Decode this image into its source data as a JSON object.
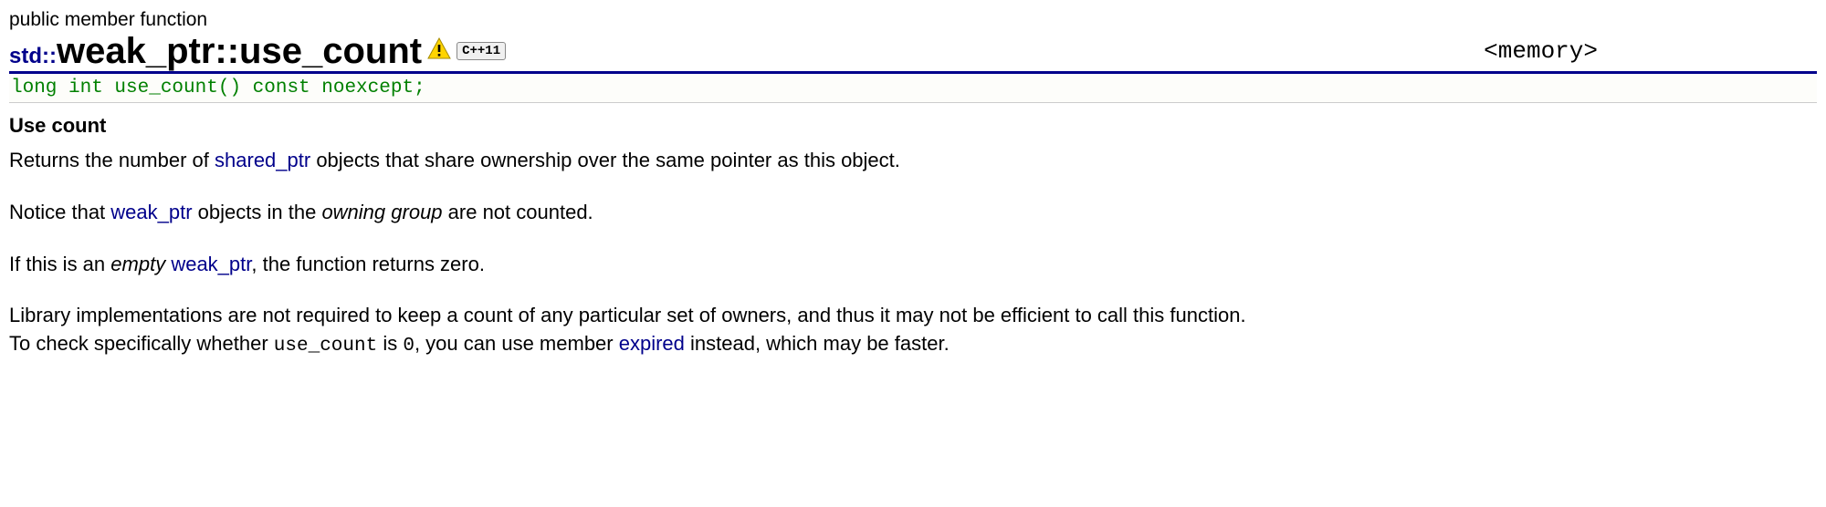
{
  "header": {
    "category_label": "public member function",
    "namespace_prefix": "std::",
    "class_name": "weak_ptr",
    "separator": "::",
    "member_name": "use_count",
    "cpp_badge": "C++11",
    "include_header": "<memory>"
  },
  "signature": "long int use_count() const noexcept;",
  "subhead": "Use count",
  "para1": {
    "t1": "Returns the number of ",
    "link_shared_ptr": "shared_ptr",
    "t2": " objects that share ownership over the same pointer as this object."
  },
  "para2": {
    "t1": "Notice that ",
    "link_weak_ptr": "weak_ptr",
    "t2": " objects in the ",
    "em1": "owning group",
    "t3": " are not counted."
  },
  "para3": {
    "t1": "If this is an ",
    "em1": "empty",
    "t2": " ",
    "link_weak_ptr": "weak_ptr",
    "t3": ", the function returns zero."
  },
  "para4": {
    "t1": "Library implementations are not required to keep a count of any particular set of owners, and thus it may not be efficient to call this function. To check specifically whether ",
    "tt_usecount": "use_count",
    "t2": " is ",
    "tt_zero": "0",
    "t3": ", you can use member ",
    "link_expired": "expired",
    "t4": " instead, which may be faster."
  }
}
